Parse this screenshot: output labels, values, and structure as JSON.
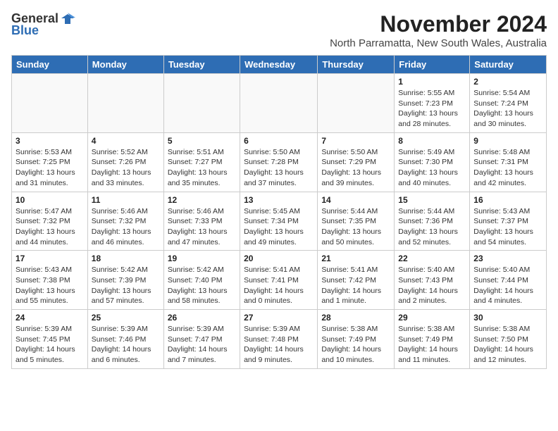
{
  "logo": {
    "general": "General",
    "blue": "Blue"
  },
  "title": "November 2024",
  "subtitle": "North Parramatta, New South Wales, Australia",
  "weekdays": [
    "Sunday",
    "Monday",
    "Tuesday",
    "Wednesday",
    "Thursday",
    "Friday",
    "Saturday"
  ],
  "weeks": [
    [
      {
        "day": "",
        "info": ""
      },
      {
        "day": "",
        "info": ""
      },
      {
        "day": "",
        "info": ""
      },
      {
        "day": "",
        "info": ""
      },
      {
        "day": "",
        "info": ""
      },
      {
        "day": "1",
        "info": "Sunrise: 5:55 AM\nSunset: 7:23 PM\nDaylight: 13 hours\nand 28 minutes."
      },
      {
        "day": "2",
        "info": "Sunrise: 5:54 AM\nSunset: 7:24 PM\nDaylight: 13 hours\nand 30 minutes."
      }
    ],
    [
      {
        "day": "3",
        "info": "Sunrise: 5:53 AM\nSunset: 7:25 PM\nDaylight: 13 hours\nand 31 minutes."
      },
      {
        "day": "4",
        "info": "Sunrise: 5:52 AM\nSunset: 7:26 PM\nDaylight: 13 hours\nand 33 minutes."
      },
      {
        "day": "5",
        "info": "Sunrise: 5:51 AM\nSunset: 7:27 PM\nDaylight: 13 hours\nand 35 minutes."
      },
      {
        "day": "6",
        "info": "Sunrise: 5:50 AM\nSunset: 7:28 PM\nDaylight: 13 hours\nand 37 minutes."
      },
      {
        "day": "7",
        "info": "Sunrise: 5:50 AM\nSunset: 7:29 PM\nDaylight: 13 hours\nand 39 minutes."
      },
      {
        "day": "8",
        "info": "Sunrise: 5:49 AM\nSunset: 7:30 PM\nDaylight: 13 hours\nand 40 minutes."
      },
      {
        "day": "9",
        "info": "Sunrise: 5:48 AM\nSunset: 7:31 PM\nDaylight: 13 hours\nand 42 minutes."
      }
    ],
    [
      {
        "day": "10",
        "info": "Sunrise: 5:47 AM\nSunset: 7:32 PM\nDaylight: 13 hours\nand 44 minutes."
      },
      {
        "day": "11",
        "info": "Sunrise: 5:46 AM\nSunset: 7:32 PM\nDaylight: 13 hours\nand 46 minutes."
      },
      {
        "day": "12",
        "info": "Sunrise: 5:46 AM\nSunset: 7:33 PM\nDaylight: 13 hours\nand 47 minutes."
      },
      {
        "day": "13",
        "info": "Sunrise: 5:45 AM\nSunset: 7:34 PM\nDaylight: 13 hours\nand 49 minutes."
      },
      {
        "day": "14",
        "info": "Sunrise: 5:44 AM\nSunset: 7:35 PM\nDaylight: 13 hours\nand 50 minutes."
      },
      {
        "day": "15",
        "info": "Sunrise: 5:44 AM\nSunset: 7:36 PM\nDaylight: 13 hours\nand 52 minutes."
      },
      {
        "day": "16",
        "info": "Sunrise: 5:43 AM\nSunset: 7:37 PM\nDaylight: 13 hours\nand 54 minutes."
      }
    ],
    [
      {
        "day": "17",
        "info": "Sunrise: 5:43 AM\nSunset: 7:38 PM\nDaylight: 13 hours\nand 55 minutes."
      },
      {
        "day": "18",
        "info": "Sunrise: 5:42 AM\nSunset: 7:39 PM\nDaylight: 13 hours\nand 57 minutes."
      },
      {
        "day": "19",
        "info": "Sunrise: 5:42 AM\nSunset: 7:40 PM\nDaylight: 13 hours\nand 58 minutes."
      },
      {
        "day": "20",
        "info": "Sunrise: 5:41 AM\nSunset: 7:41 PM\nDaylight: 14 hours\nand 0 minutes."
      },
      {
        "day": "21",
        "info": "Sunrise: 5:41 AM\nSunset: 7:42 PM\nDaylight: 14 hours\nand 1 minute."
      },
      {
        "day": "22",
        "info": "Sunrise: 5:40 AM\nSunset: 7:43 PM\nDaylight: 14 hours\nand 2 minutes."
      },
      {
        "day": "23",
        "info": "Sunrise: 5:40 AM\nSunset: 7:44 PM\nDaylight: 14 hours\nand 4 minutes."
      }
    ],
    [
      {
        "day": "24",
        "info": "Sunrise: 5:39 AM\nSunset: 7:45 PM\nDaylight: 14 hours\nand 5 minutes."
      },
      {
        "day": "25",
        "info": "Sunrise: 5:39 AM\nSunset: 7:46 PM\nDaylight: 14 hours\nand 6 minutes."
      },
      {
        "day": "26",
        "info": "Sunrise: 5:39 AM\nSunset: 7:47 PM\nDaylight: 14 hours\nand 7 minutes."
      },
      {
        "day": "27",
        "info": "Sunrise: 5:39 AM\nSunset: 7:48 PM\nDaylight: 14 hours\nand 9 minutes."
      },
      {
        "day": "28",
        "info": "Sunrise: 5:38 AM\nSunset: 7:49 PM\nDaylight: 14 hours\nand 10 minutes."
      },
      {
        "day": "29",
        "info": "Sunrise: 5:38 AM\nSunset: 7:49 PM\nDaylight: 14 hours\nand 11 minutes."
      },
      {
        "day": "30",
        "info": "Sunrise: 5:38 AM\nSunset: 7:50 PM\nDaylight: 14 hours\nand 12 minutes."
      }
    ]
  ]
}
